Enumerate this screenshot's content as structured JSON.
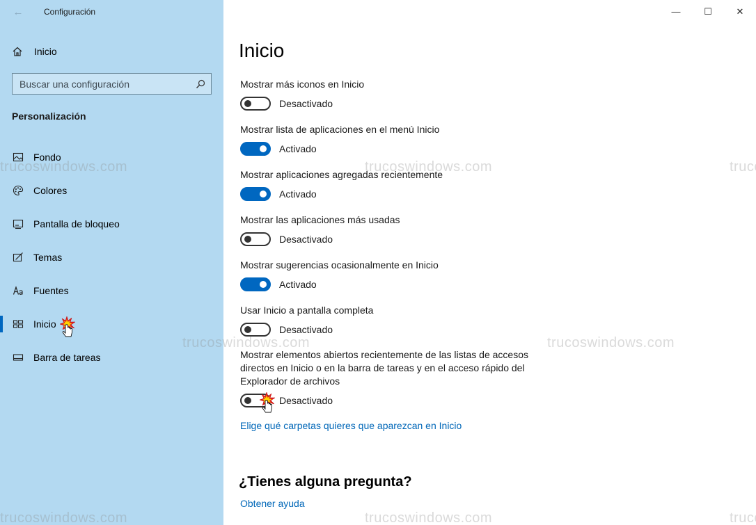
{
  "window": {
    "title": "Configuración",
    "back_glyph": "←",
    "controls": {
      "minimize": "—",
      "maximize": "☐",
      "close": "✕"
    }
  },
  "sidebar": {
    "home_label": "Inicio",
    "search_placeholder": "Buscar una configuración",
    "section_title": "Personalización",
    "items": [
      {
        "label": "Fondo",
        "icon": "picture-icon"
      },
      {
        "label": "Colores",
        "icon": "palette-icon"
      },
      {
        "label": "Pantalla de bloqueo",
        "icon": "lock-screen-icon"
      },
      {
        "label": "Temas",
        "icon": "themes-icon"
      },
      {
        "label": "Fuentes",
        "icon": "fonts-icon"
      },
      {
        "label": "Inicio",
        "icon": "start-icon",
        "selected": true
      },
      {
        "label": "Barra de tareas",
        "icon": "taskbar-icon"
      }
    ]
  },
  "main": {
    "title": "Inicio",
    "settings": [
      {
        "label": "Mostrar más iconos en Inicio",
        "state": "Desactivado",
        "on": false
      },
      {
        "label": "Mostrar lista de aplicaciones en el menú Inicio",
        "state": "Activado",
        "on": true
      },
      {
        "label": "Mostrar aplicaciones agregadas recientemente",
        "state": "Activado",
        "on": true
      },
      {
        "label": "Mostrar las aplicaciones más usadas",
        "state": "Desactivado",
        "on": false
      },
      {
        "label": "Mostrar sugerencias ocasionalmente en Inicio",
        "state": "Activado",
        "on": true
      },
      {
        "label": "Usar Inicio a pantalla completa",
        "state": "Desactivado",
        "on": false
      },
      {
        "label": "Mostrar elementos abiertos recientemente de las listas de accesos directos en Inicio o en la barra de tareas y en el acceso rápido del Explorador de archivos",
        "state": "Desactivado",
        "on": false
      }
    ],
    "folders_link": "Elige qué carpetas quieres que aparezcan en Inicio",
    "question_heading": "¿Tienes alguna pregunta?",
    "help_link": "Obtener ayuda"
  },
  "watermark": "trucoswindows.com",
  "colors": {
    "sidebar_bg": "#b3d9f1",
    "accent": "#0067c0",
    "link": "#0067b8"
  }
}
